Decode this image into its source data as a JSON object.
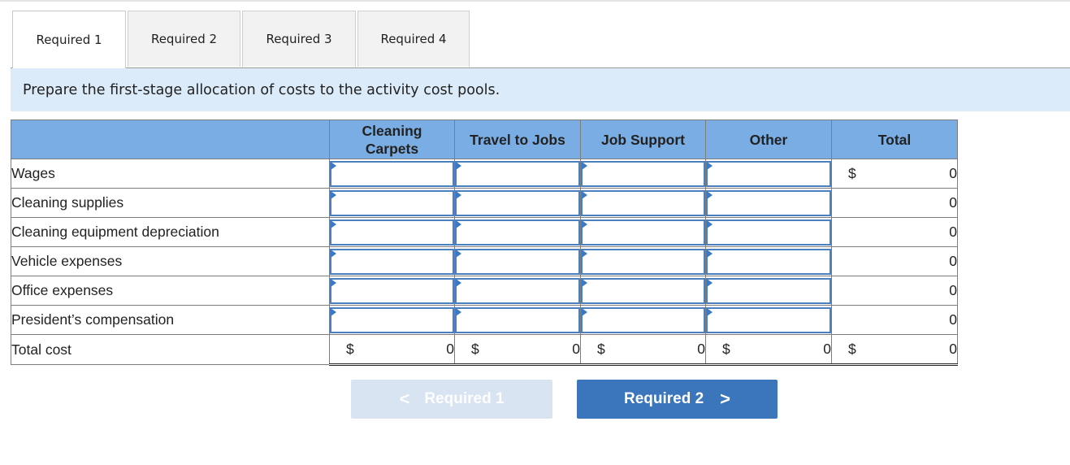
{
  "tabs": [
    {
      "label": "Required 1",
      "active": true
    },
    {
      "label": "Required 2",
      "active": false
    },
    {
      "label": "Required 3",
      "active": false
    },
    {
      "label": "Required 4",
      "active": false
    }
  ],
  "instruction": "Prepare the first-stage allocation of costs to the activity cost pools.",
  "table": {
    "headers": [
      "",
      "Cleaning Carpets",
      "Travel to Jobs",
      "Job Support",
      "Other",
      "Total"
    ],
    "rows": [
      {
        "label": "Wages",
        "inputs": [
          "",
          "",
          "",
          ""
        ],
        "total": "0",
        "total_dollar": "$"
      },
      {
        "label": "Cleaning supplies",
        "inputs": [
          "",
          "",
          "",
          ""
        ],
        "total": "0",
        "total_dollar": ""
      },
      {
        "label": "Cleaning equipment depreciation",
        "inputs": [
          "",
          "",
          "",
          ""
        ],
        "total": "0",
        "total_dollar": ""
      },
      {
        "label": "Vehicle expenses",
        "inputs": [
          "",
          "",
          "",
          ""
        ],
        "total": "0",
        "total_dollar": ""
      },
      {
        "label": "Office expenses",
        "inputs": [
          "",
          "",
          "",
          ""
        ],
        "total": "0",
        "total_dollar": ""
      },
      {
        "label": "President’s compensation",
        "inputs": [
          "",
          "",
          "",
          ""
        ],
        "total": "0",
        "total_dollar": ""
      }
    ],
    "total_row": {
      "label": "Total cost",
      "currency": "$",
      "values": [
        "0",
        "0",
        "0",
        "0",
        "0"
      ]
    }
  },
  "nav": {
    "prev_label": "Required 1",
    "next_label": "Required 2",
    "prev_icon": "chevron-left-icon",
    "next_icon": "chevron-right-icon",
    "prev_glyph": "<",
    "next_glyph": ">"
  },
  "colors": {
    "header_bg": "#7aade3",
    "instruction_bg": "#dcebf9",
    "input_border": "#4a7fc0",
    "next_button": "#3b76bc",
    "prev_button_disabled": "#d8e4f1"
  }
}
